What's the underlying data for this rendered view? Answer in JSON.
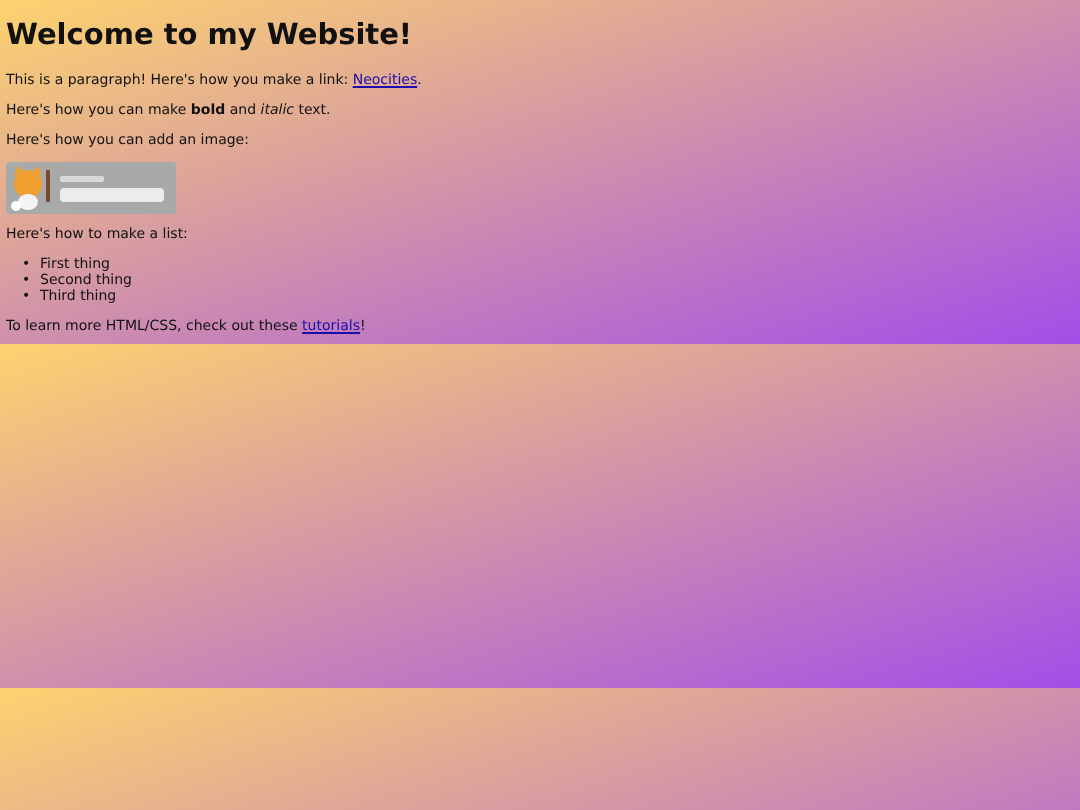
{
  "heading": "Welcome to my Website!",
  "blocks": [
    {
      "kind": "paragraph",
      "before": "This is a paragraph! Here's how you make a link: ",
      "link": "Neocities",
      "after": "."
    },
    {
      "kind": "paragraph",
      "before": "Here's how you can make **bold** and *italic* text."
    },
    {
      "kind": "paragraph",
      "before": "Here's how you can add an image:"
    },
    {
      "kind": "picture"
    },
    {
      "kind": "paragraph",
      "before": "Here's how to make a list:"
    },
    {
      "kind": "list",
      "items": [
        {
          "marker": "•",
          "text": "First thing"
        },
        {
          "marker": "•",
          "text": "Second thing"
        },
        {
          "marker": "•",
          "text": "Third thing"
        }
      ]
    },
    {
      "kind": "paragraph",
      "before": "To learn more HTML/CSS, check out these ",
      "link": "tutorials",
      "after": "!"
    }
  ]
}
